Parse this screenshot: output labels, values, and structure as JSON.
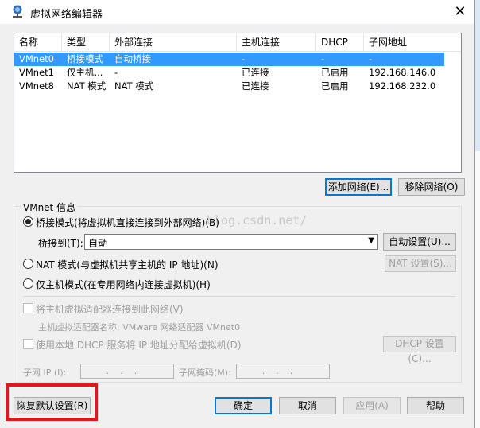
{
  "window": {
    "title": "虚拟网络编辑器",
    "close_glyph": "✕"
  },
  "table": {
    "columns": [
      "名称",
      "类型",
      "外部连接",
      "主机连接",
      "DHCP",
      "子网地址"
    ],
    "rows": [
      {
        "name": "VMnet0",
        "type": "桥接模式",
        "external": "自动桥接",
        "host": "-",
        "dhcp": "-",
        "subnet": "-",
        "selected": true
      },
      {
        "name": "VMnet1",
        "type": "仅主机...",
        "external": "-",
        "host": "已连接",
        "dhcp": "已启用",
        "subnet": "192.168.146.0",
        "selected": false
      },
      {
        "name": "VMnet8",
        "type": "NAT 模式",
        "external": "NAT 模式",
        "host": "已连接",
        "dhcp": "已启用",
        "subnet": "192.168.232.0",
        "selected": false
      }
    ]
  },
  "net_buttons": {
    "add": "添加网络(E)...",
    "remove": "移除网络(O)"
  },
  "vmnet_info": {
    "group_label": "VMnet 信息",
    "bridged": {
      "label": "桥接模式(将虚拟机直接连接到外部网络)(B)",
      "checked": true
    },
    "bridge_to": {
      "label": "桥接到(T):",
      "value": "自动",
      "auto_btn": "自动设置(U)..."
    },
    "nat": {
      "label": "NAT 模式(与虚拟机共享主机的 IP 地址)(N)",
      "settings_btn": "NAT 设置(S)..."
    },
    "hostonly": {
      "label": "仅主机模式(在专用网络内连接虚拟机)(H)"
    },
    "connect_adapter": {
      "label": "将主机虚拟适配器连接到此网络(V)"
    },
    "adapter_name": "主机虚拟适配器名称: VMware 网络适配器 VMnet0",
    "dhcp": {
      "label": "使用本地 DHCP 服务将 IP 地址分配给虚拟机(D)",
      "settings_btn": "DHCP 设置(C)..."
    },
    "subnet_ip_label": "子网 IP (I):",
    "subnet_mask_label": "子网掩码(M):",
    "ip_placeholder": "...",
    "mask_placeholder": "..."
  },
  "watermark": "blog.csdn.net/",
  "footer": {
    "restore": "恢复默认设置(R)",
    "ok": "确定",
    "cancel": "取消",
    "apply": "应用(A)",
    "help": "帮助"
  },
  "colors": {
    "selection": "#3399ff",
    "highlight_box": "#e8131b",
    "focus_border": "#0078d7"
  }
}
